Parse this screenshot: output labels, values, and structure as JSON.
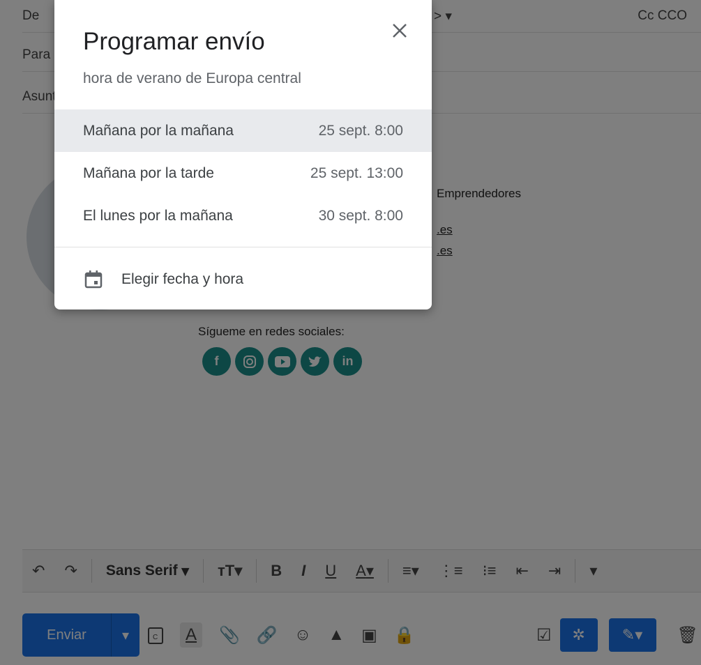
{
  "compose": {
    "from_label": "De",
    "from_value": "",
    "to_label": "Para",
    "subject_label": "Asunto",
    "cc_bcc": "Cc CCO"
  },
  "signature": {
    "line_org": "Emprendedores",
    "link1": ".es",
    "link2": ".es",
    "social_label": "Sígueme en redes sociales:",
    "social_icons": [
      "facebook-icon",
      "instagram-icon",
      "youtube-icon",
      "twitter-icon",
      "linkedin-icon"
    ]
  },
  "toolbar": {
    "font": "Sans Serif",
    "bold": "B",
    "italic": "I",
    "underline": "U",
    "text_color": "A"
  },
  "bottom": {
    "send_label": "Enviar"
  },
  "dialog": {
    "title": "Programar envío",
    "subtitle": "hora de verano de Europa central",
    "options": [
      {
        "name": "Mañana por la mañana",
        "time": "25 sept. 8:00"
      },
      {
        "name": "Mañana por la tarde",
        "time": "25 sept. 13:00"
      },
      {
        "name": "El lunes por la mañana",
        "time": "30 sept. 8:00"
      }
    ],
    "custom_label": "Elegir fecha y hora"
  },
  "colors": {
    "accent": "#1a73e8",
    "social": "#1a8f8a",
    "selected_option": "#e8eaed"
  }
}
